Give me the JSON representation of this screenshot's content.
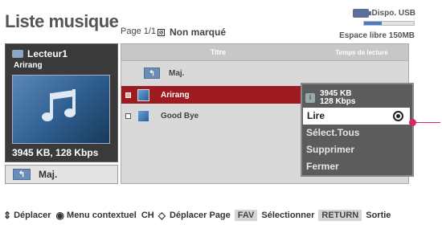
{
  "header": {
    "title": "Liste musique",
    "page": "Page 1/1",
    "mark_label": "Non marqué",
    "usb_label": "Dispo. USB",
    "free_space": "Espace libre 150MB",
    "free_space_fill_percent": 35
  },
  "player": {
    "name": "Lecteur1",
    "track": "Arirang",
    "file_info": "3945 KB, 128 Kbps",
    "up_button": "Maj."
  },
  "list": {
    "col_title": "Titre",
    "col_duration": "Temps de lecture",
    "rows": [
      {
        "label": "Maj.",
        "kind": "folder-up",
        "selected": false
      },
      {
        "label": "Arirang",
        "kind": "track",
        "selected": true
      },
      {
        "label": "Good Bye",
        "kind": "track",
        "selected": false
      }
    ]
  },
  "context_menu": {
    "info_line1": "3945 KB",
    "info_line2": "128 Kbps",
    "items": [
      "Lire",
      "Sélect.Tous",
      "Supprimer",
      "Fermer"
    ],
    "active_index": 0
  },
  "footer": {
    "move": "Déplacer",
    "context": "Menu contextuel",
    "ch_key": "CH",
    "move_page": "Déplacer Page",
    "fav_key": "FAV",
    "select": "Sélectionner",
    "return_key": "RETURN",
    "exit": "Sortie"
  },
  "colors": {
    "selected_row": "#9e1b1f",
    "pointer": "#d8256a"
  }
}
